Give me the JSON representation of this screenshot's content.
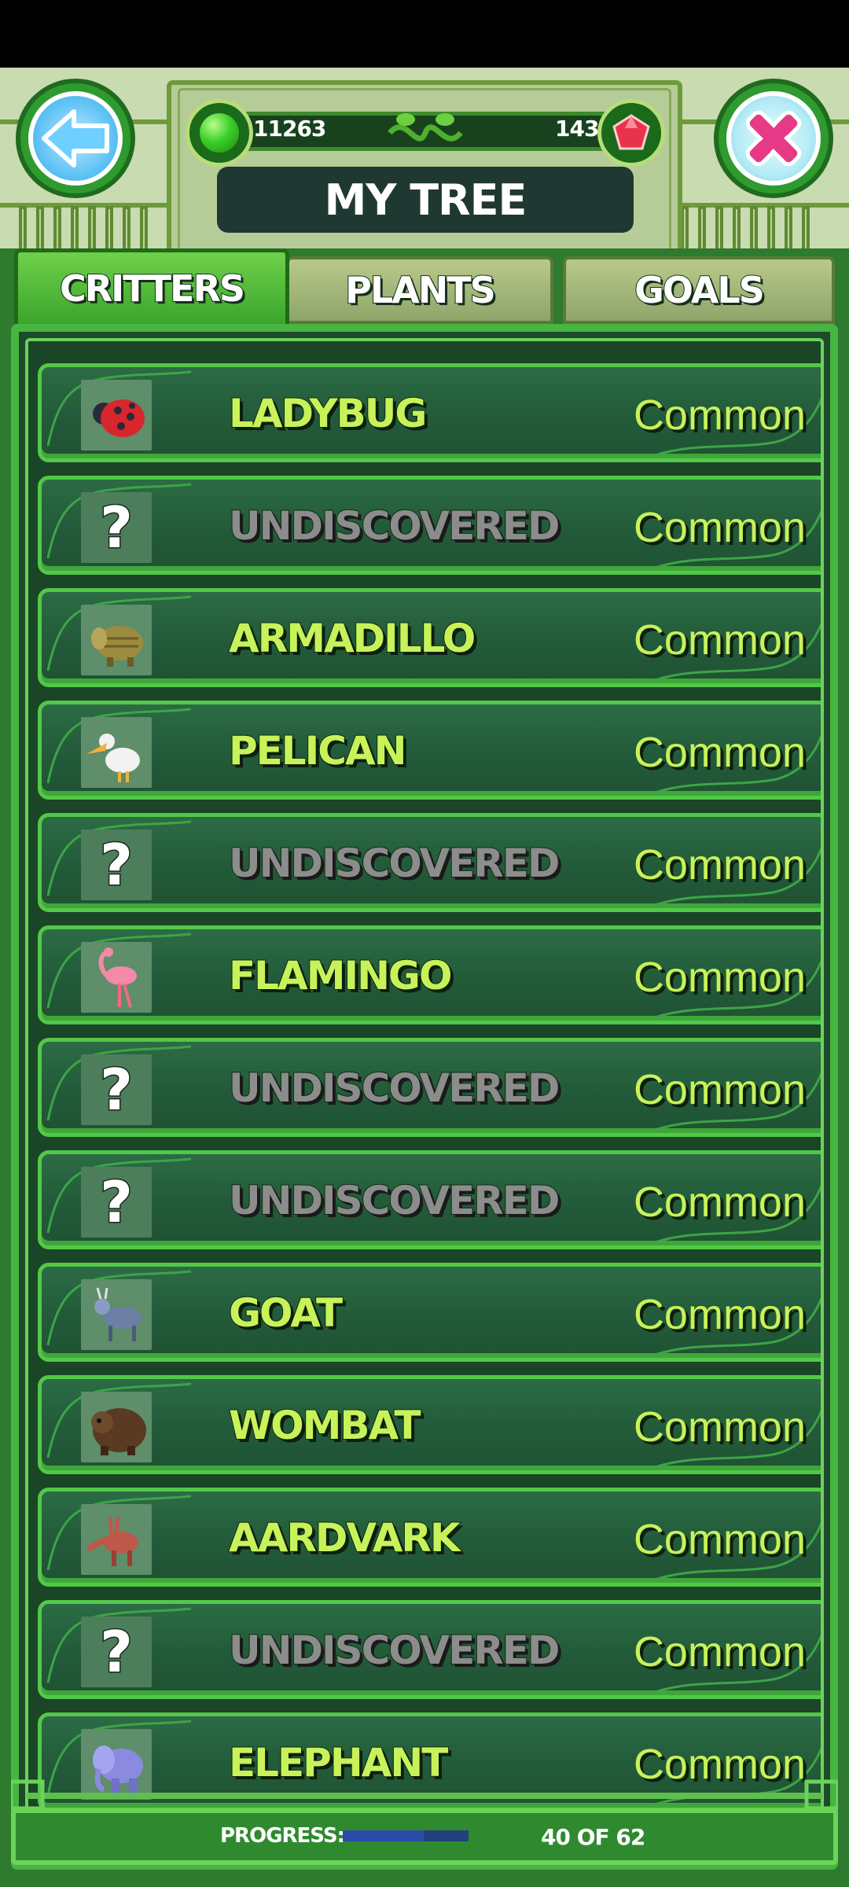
{
  "header": {
    "title": "MY TREE",
    "green_currency": "11263",
    "red_currency": "143"
  },
  "tabs": [
    {
      "label": "CRITTERS",
      "active": true
    },
    {
      "label": "PLANTS",
      "active": false
    },
    {
      "label": "GOALS",
      "active": false
    }
  ],
  "critters": [
    {
      "name": "LADYBUG",
      "rarity": "Common",
      "discovered": true,
      "icon": "ladybug-icon"
    },
    {
      "name": "UNDISCOVERED",
      "rarity": "Common",
      "discovered": false,
      "icon": "question-mark-icon"
    },
    {
      "name": "ARMADILLO",
      "rarity": "Common",
      "discovered": true,
      "icon": "armadillo-icon"
    },
    {
      "name": "PELICAN",
      "rarity": "Common",
      "discovered": true,
      "icon": "pelican-icon"
    },
    {
      "name": "UNDISCOVERED",
      "rarity": "Common",
      "discovered": false,
      "icon": "question-mark-icon"
    },
    {
      "name": "FLAMINGO",
      "rarity": "Common",
      "discovered": true,
      "icon": "flamingo-icon"
    },
    {
      "name": "UNDISCOVERED",
      "rarity": "Common",
      "discovered": false,
      "icon": "question-mark-icon"
    },
    {
      "name": "UNDISCOVERED",
      "rarity": "Common",
      "discovered": false,
      "icon": "question-mark-icon"
    },
    {
      "name": "GOAT",
      "rarity": "Common",
      "discovered": true,
      "icon": "goat-icon"
    },
    {
      "name": "WOMBAT",
      "rarity": "Common",
      "discovered": true,
      "icon": "wombat-icon"
    },
    {
      "name": "AARDVARK",
      "rarity": "Common",
      "discovered": true,
      "icon": "aardvark-icon"
    },
    {
      "name": "UNDISCOVERED",
      "rarity": "Common",
      "discovered": false,
      "icon": "question-mark-icon"
    },
    {
      "name": "ELEPHANT",
      "rarity": "Common",
      "discovered": true,
      "icon": "elephant-icon"
    }
  ],
  "footer": {
    "progress_label": "PROGRESS:",
    "progress_text": "40 OF 62",
    "progress_fraction": 0.645
  },
  "colors": {
    "name_discovered": "#c8f25a",
    "name_undiscovered": "#8c8c8c",
    "row_border": "#52c848"
  }
}
